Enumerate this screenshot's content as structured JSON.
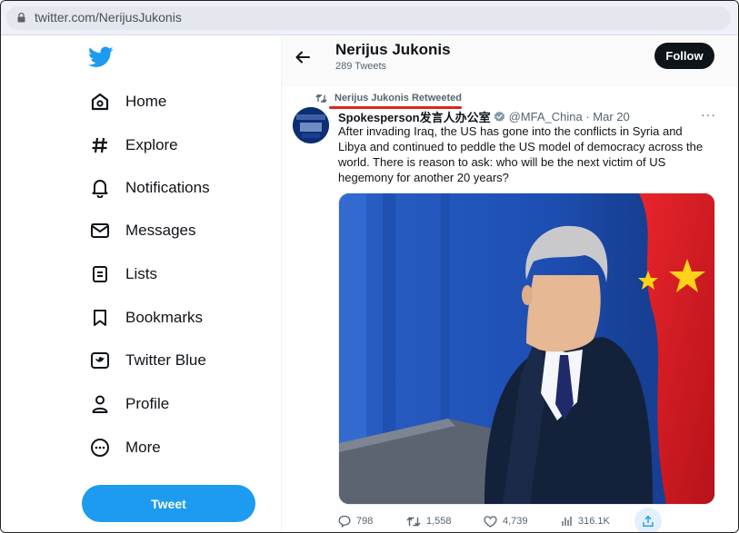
{
  "browser": {
    "url": "twitter.com/NerijusJukonis"
  },
  "sidebar": {
    "items": [
      {
        "label": "Home",
        "icon": "home-icon"
      },
      {
        "label": "Explore",
        "icon": "hashtag-icon"
      },
      {
        "label": "Notifications",
        "icon": "bell-icon"
      },
      {
        "label": "Messages",
        "icon": "envelope-icon"
      },
      {
        "label": "Lists",
        "icon": "list-icon"
      },
      {
        "label": "Bookmarks",
        "icon": "bookmark-icon"
      },
      {
        "label": "Twitter Blue",
        "icon": "twitter-blue-icon"
      },
      {
        "label": "Profile",
        "icon": "person-icon"
      },
      {
        "label": "More",
        "icon": "more-circle-icon"
      }
    ],
    "tweet_button": "Tweet"
  },
  "header": {
    "name": "Nerijus Jukonis",
    "tweet_count": "289 Tweets",
    "follow_label": "Follow"
  },
  "tweet": {
    "retweet_label": "Nerijus Jukonis Retweeted",
    "author_name": "Spokesperson发言人办公室",
    "handle_date": "@MFA_China · Mar 20",
    "more": "···",
    "text": "After invading Iraq, the US has gone into the conflicts in Syria and Libya and continued to peddle the US model of democracy across the world. There is reason to ask: who will be the next victim of US hegemony for another 20 years?",
    "replies": "798",
    "retweets": "1,558",
    "likes": "4,739",
    "views": "316.1K"
  },
  "colors": {
    "accent": "#1d9bf0",
    "follow_bg": "#0f1419",
    "annotation_red": "#e0231f"
  }
}
